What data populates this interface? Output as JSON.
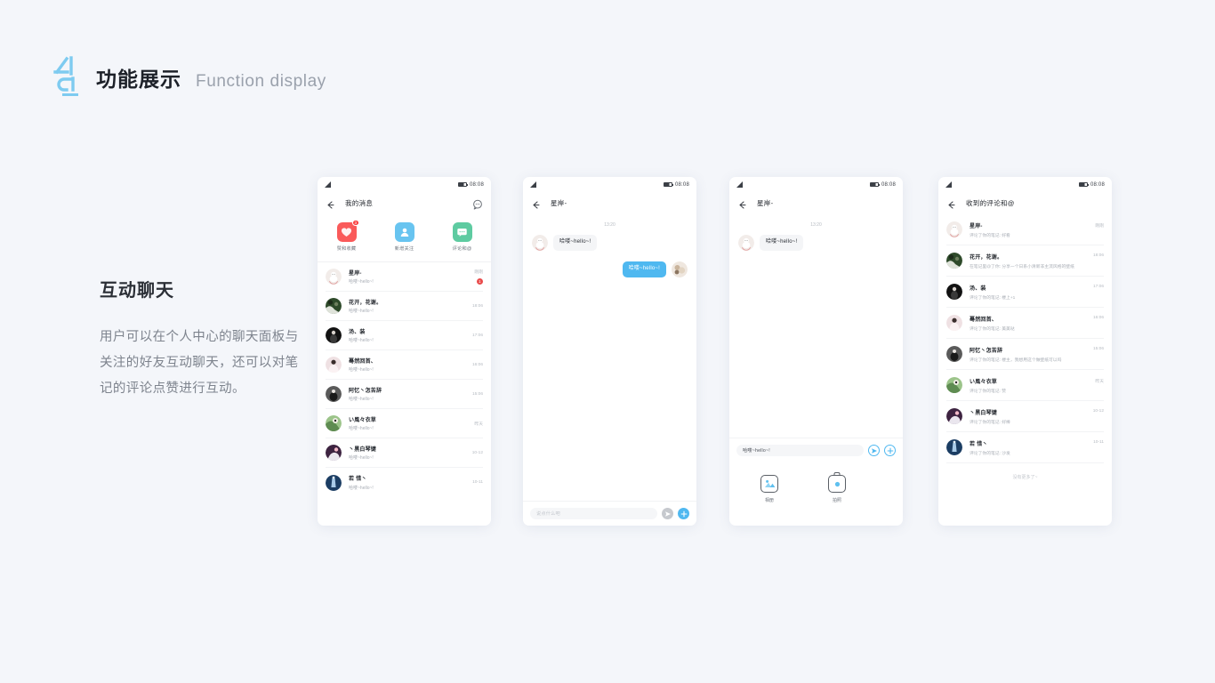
{
  "header": {
    "logo_name": "AL-logo",
    "title_cn": "功能展示",
    "title_en": "Function display",
    "accent_color": "#7ecbf0"
  },
  "copy": {
    "title": "互动聊天",
    "body": "用户可以在个人中心的聊天面板与关注的好友互动聊天，还可以对笔记的评论点赞进行互动。"
  },
  "status_bar": {
    "time": "08:08"
  },
  "phone1": {
    "nav_title": "我的消息",
    "back_icon": "back-arrow-icon",
    "right_icon": "smiley-chat-icon",
    "entries": [
      {
        "label": "赞和收藏",
        "icon": "heart-icon",
        "color": "#fa5a5a",
        "badge": "3"
      },
      {
        "label": "新增关注",
        "icon": "person-icon",
        "color": "#68c4f0",
        "badge": ""
      },
      {
        "label": "评论和@",
        "icon": "comment-icon",
        "color": "#5ecba1",
        "badge": ""
      }
    ],
    "messages": [
      {
        "name": "星岸-",
        "sub": "哈喽~hello~!",
        "time": "刚刚",
        "badge": "1"
      },
      {
        "name": "花开，花谢。",
        "sub": "哈喽~hello~!",
        "time": "18:06",
        "badge": ""
      },
      {
        "name": "汤、装",
        "sub": "哈喽~hello~!",
        "time": "17:06",
        "badge": ""
      },
      {
        "name": "蓦然回首、",
        "sub": "哈喽~hello~!",
        "time": "16:06",
        "badge": ""
      },
      {
        "name": "阿忆丶怎苦辞",
        "sub": "哈喽~hello~!",
        "time": "15:06",
        "badge": ""
      },
      {
        "name": "い風々衣草",
        "sub": "哈喽~hello~!",
        "time": "昨天",
        "badge": ""
      },
      {
        "name": "丶黑白琴键",
        "sub": "哈喽~hello~!",
        "time": "10-12",
        "badge": ""
      },
      {
        "name": "若 惜丶",
        "sub": "哈喽~hello~!",
        "time": "10-11",
        "badge": ""
      }
    ]
  },
  "phone2": {
    "nav_title": "星岸-",
    "back_icon": "back-arrow-icon",
    "chat_time": "13:20",
    "bubbles": [
      {
        "side": "them",
        "text": "哈喽~hello~!"
      },
      {
        "side": "me",
        "text": "哈喽~hello~!"
      }
    ],
    "input_placeholder": "说点什么吧",
    "input_value": "",
    "send_icon": "send-icon",
    "plus_icon": "plus-icon"
  },
  "phone3": {
    "nav_title": "星岸-",
    "back_icon": "back-arrow-icon",
    "chat_time": "13:20",
    "bubbles": [
      {
        "side": "them",
        "text": "哈喽~hello~!"
      }
    ],
    "input_placeholder": "说点什么吧",
    "input_value": "哈喽~hello~!",
    "send_icon": "send-icon",
    "plus_icon": "plus-icon",
    "attachments": [
      {
        "label": "相册",
        "icon": "album-icon"
      },
      {
        "label": "拍照",
        "icon": "camera-icon"
      }
    ]
  },
  "phone4": {
    "nav_title": "收到的评论和@",
    "back_icon": "back-arrow-icon",
    "comments": [
      {
        "name": "星岸-",
        "sub": "评论了你的笔记: 好看",
        "time": "刚刚"
      },
      {
        "name": "花开，花谢。",
        "sub": "在笔记里@了你: 分享一个日系小清新非主流风格的壁纸",
        "time": "18:06"
      },
      {
        "name": "汤、装",
        "sub": "评论了你的笔记: 楼上+1",
        "time": "17:06"
      },
      {
        "name": "蓦然回首、",
        "sub": "评论了你的笔记: 美美哒",
        "time": "16:06"
      },
      {
        "name": "阿忆丶怎苦辞",
        "sub": "评论了你的笔记: 楼主，我想用这个做壁纸可以吗",
        "time": "15:06"
      },
      {
        "name": "い風々衣草",
        "sub": "评论了你的笔记: 赞",
        "time": "昨天"
      },
      {
        "name": "丶黑白琴键",
        "sub": "评论了你的笔记: 好棒",
        "time": "10-12"
      },
      {
        "name": "若 惜丶",
        "sub": "评论了你的笔记: 沙发",
        "time": "10-11"
      }
    ],
    "no_more": "没有更多了~"
  }
}
